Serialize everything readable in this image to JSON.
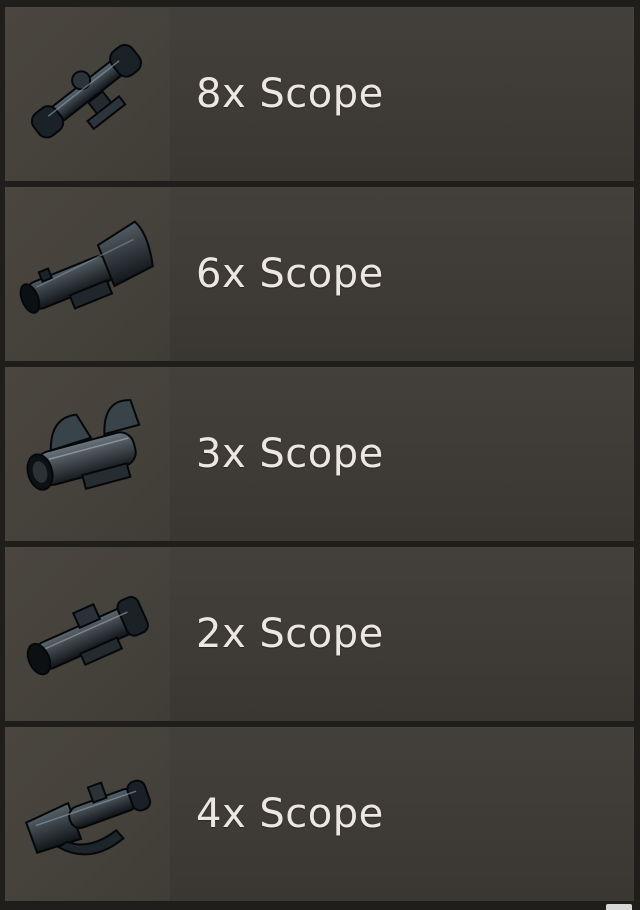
{
  "items": [
    {
      "label": "8x Scope",
      "icon": "scope-8x-icon"
    },
    {
      "label": "6x Scope",
      "icon": "scope-6x-icon"
    },
    {
      "label": "3x Scope",
      "icon": "scope-3x-icon"
    },
    {
      "label": "2x Scope",
      "icon": "scope-2x-icon"
    },
    {
      "label": "4x Scope",
      "icon": "scope-4x-icon"
    }
  ],
  "colors": {
    "panel": "#3e3a35",
    "thumb": "#45413b",
    "text": "#ece8e1",
    "background": "#1f1e1b"
  }
}
